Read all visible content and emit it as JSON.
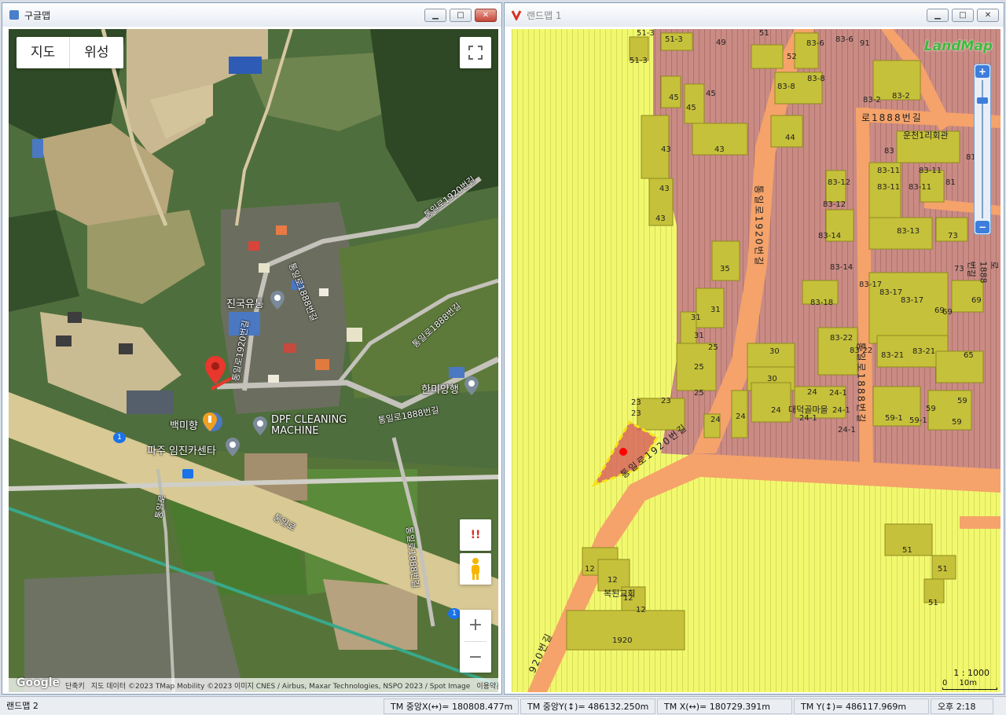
{
  "left_window": {
    "title": "구글맵",
    "map_type": {
      "map_label": "지도",
      "satellite_label": "위성"
    },
    "fullscreen_icon": "fullscreen-icon",
    "places": {
      "jinguk": "진국유통",
      "hanmi": "한미양행",
      "baekmi": "백미향",
      "dpf": "DPF CLEANING\nMACHINE",
      "paju": "파주 임진카센타"
    },
    "roads": {
      "r1": "통일로1920번길",
      "r2": "통일로1888번길",
      "r3": "통일로1888번길",
      "r4": "통일로1920번길",
      "r5": "통일로1888번길",
      "r6": "통일로",
      "r7": "통일로1888번길",
      "r8": "통일로"
    },
    "route_badge": "1",
    "controls": {
      "alert": "!!",
      "zoom_in": "+",
      "zoom_out": "−"
    },
    "attribution": {
      "logo": "Google",
      "shortcuts": "단축키",
      "data": "지도 데이터 ©2023 TMap Mobility ©2023 이미지 CNES / Airbus, Maxar Technologies, NSPO 2023 / Spot Image",
      "terms": "이용약관"
    }
  },
  "right_window": {
    "title": "랜드맵 1",
    "logo": "LandMap",
    "zoom": {
      "plus": "+",
      "minus": "−"
    },
    "scale": "1 : 1000",
    "scale_bar": {
      "zero": "0",
      "ten": "10m"
    },
    "roads": {
      "main": "통일로1920번길",
      "vertical": "통일로1920번길",
      "street1888": "로1888번길",
      "street1888_vertical": "통일로1888번길",
      "right_vertical": "통일로1888번길",
      "bottom": "920번길"
    },
    "buildings": {
      "church": "복된교회",
      "village_hall": "운천1리회관",
      "daedeok": "대덕골마을"
    },
    "lots": [
      "51-3",
      "51-3",
      "49",
      "51",
      "52",
      "83-6",
      "83-6",
      "91",
      "51-3",
      "45",
      "45",
      "45",
      "83-8",
      "83-8",
      "83-2",
      "83-2",
      "43",
      "43",
      "44",
      "83",
      "83-11",
      "83-11",
      "81",
      "43",
      "43",
      "83-12",
      "83-12",
      "83-11",
      "83-11",
      "81",
      "83-14",
      "83-13",
      "73",
      "35",
      "83-14",
      "73",
      "31",
      "31",
      "83-17",
      "83-17",
      "83-17",
      "69",
      "69",
      "83-18",
      "69",
      "31",
      "25",
      "30",
      "83-22",
      "83-22",
      "83-21",
      "83-21",
      "65",
      "25",
      "30",
      "24",
      "24-1",
      "59",
      "23",
      "23",
      "25",
      "24",
      "24",
      "대덕골마을",
      "24-1",
      "59-1",
      "59",
      "23",
      "24",
      "24-1",
      "24-1",
      "59-1",
      "59",
      "12",
      "12",
      "12",
      "12",
      "1920",
      "51",
      "51",
      "51"
    ]
  },
  "statusbar": {
    "window_label": "랜드맵 2",
    "tm_center_x": "TM 중앙X(↔)= 180808.477m",
    "tm_center_y": "TM 중앙Y(↕)= 486132.250m",
    "tm_x": "TM X(↔)= 180729.391m",
    "tm_y": "TM Y(↕)= 486117.969m",
    "clock": "오후 2:18"
  }
}
